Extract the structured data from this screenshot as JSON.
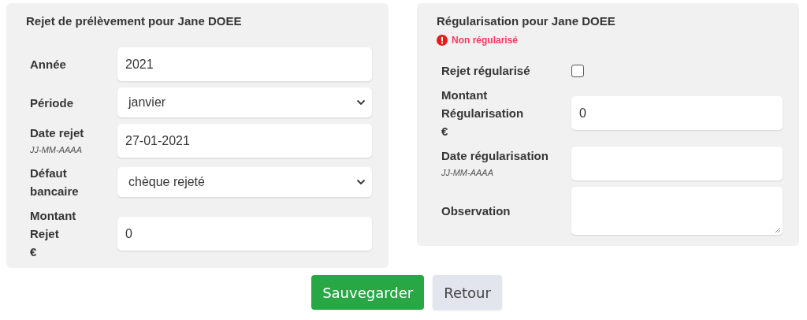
{
  "panels": [
    {
      "title": "Rejet de prélèvement pour Jane DOEE",
      "fields": [
        {
          "kind": "input",
          "label": "Année",
          "value": "2021"
        },
        {
          "kind": "select",
          "label": "Période",
          "value": "janvier"
        },
        {
          "kind": "input",
          "label": "Date rejet",
          "hint": "JJ-MM-AAAA",
          "value": "27-01-2021"
        },
        {
          "kind": "select",
          "label": "Défaut bancaire",
          "value": "chèque rejeté"
        },
        {
          "kind": "input",
          "label": "Montant Rejet",
          "unit": "€",
          "value": "0"
        }
      ]
    },
    {
      "title": "Régularisation pour Jane DOEE",
      "status": {
        "text": "Non régularisé",
        "color": "#ff3860"
      },
      "fields": [
        {
          "kind": "checkbox",
          "label": "Rejet régularisé",
          "checked": false
        },
        {
          "kind": "input",
          "label": "Montant Régularisation",
          "unit": "€",
          "value": "0"
        },
        {
          "kind": "input",
          "label": "Date régularisation",
          "hint": "JJ-MM-AAAA"
        },
        {
          "kind": "textarea",
          "label": "Observation"
        }
      ]
    }
  ],
  "buttons": [
    {
      "label": "Sauvegarder",
      "kind": "primary"
    },
    {
      "label": "Retour",
      "kind": "secondary"
    }
  ]
}
